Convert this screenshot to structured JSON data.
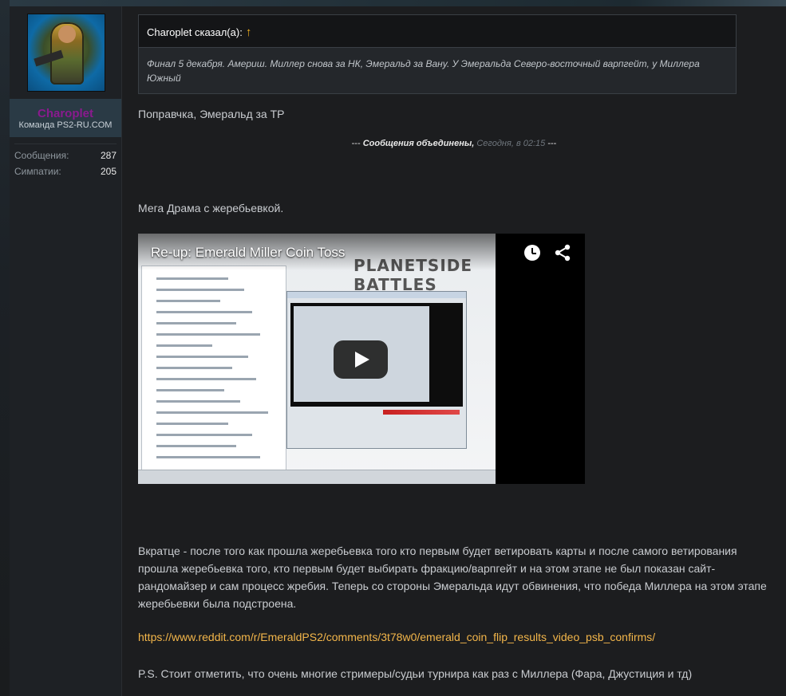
{
  "sidebar": {
    "username": "Charoplet",
    "user_title": "Команда PS2-RU.COM",
    "stats": [
      {
        "label": "Сообщения:",
        "value": "287"
      },
      {
        "label": "Симпатии:",
        "value": "205"
      }
    ]
  },
  "quote": {
    "author": "Charoplet сказал(а):",
    "arrow": "↑",
    "body": "Финал 5 декабря. Америш. Миллер снова за НК, Эмеральд за Вану. У Эмеральда Северо-восточный варпгейт, у Миллера Южный"
  },
  "post": {
    "line1": "Поправчка, Эмеральд за ТР",
    "merged_label": "Сообщения объединены,",
    "merged_time": "Сегодня, в 02:15",
    "merged_dashes_left": "---",
    "merged_dashes_right": "---",
    "line2": "Мега Драма с жеребьевкой.",
    "paragraph": "Вкратце - после того как прошла жеребьевка того кто первым будет ветировать карты и после самого ветирования прошла жеребьевка того, кто первым будет выбирать фракцию/варпгейт и на этом этапе не был показан сайт-рандомайзер и сам процесс жребия. Теперь со стороны Эмеральда идут обвинения, что победа Миллера на этом этапе жеребьевки была подстроена.",
    "link": "https://www.reddit.com/r/EmeraldPS2/comments/3t78w0/emerald_coin_flip_results_video_psb_confirms/",
    "ps": "P.S. Стоит отметить, что очень многие стримеры/судьи турнира как раз с Миллера (Фара, Джустиция и тд)"
  },
  "video": {
    "title": "Re-up: Emerald Miller Coin Toss",
    "logo_text": "PLANETSIDE BATTLES",
    "icons": [
      "clock-icon",
      "share-icon",
      "play-icon"
    ]
  },
  "colors": {
    "username": "#8a1a8e",
    "link": "#f3b64a",
    "quote_arrow": "#f2b01e"
  }
}
